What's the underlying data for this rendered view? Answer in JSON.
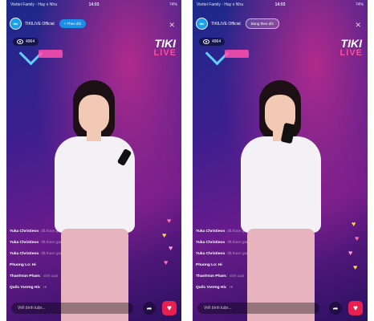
{
  "phones": [
    {
      "status": {
        "carrier": "Viettel Family - Hay o Nha",
        "time": "14:03",
        "battery": "74%"
      },
      "channel": {
        "name": "TIKILIVE Official",
        "avatar_text": "tiki",
        "follow_label": "+ Theo dõi"
      },
      "viewers": "4964",
      "brand": {
        "tiki": "TIKI",
        "live": "LIVE"
      },
      "comments": [
        {
          "name": "Yuka Christieoo",
          "msg": "đã tham gia"
        },
        {
          "name": "Yuka Christieoo",
          "msg": "đã tham gia"
        },
        {
          "name": "Yuka Christieoo",
          "msg": "đã tham gia"
        },
        {
          "name": "Phuong Lo: Hi",
          "msg": ""
        },
        {
          "name": "ThanhVan Pham:",
          "msg": "xinh quá"
        },
        {
          "name": "Quốc Vương Hà:",
          "msg": "Hi"
        }
      ],
      "chat_placeholder": "Viết bình luận..."
    },
    {
      "status": {
        "carrier": "Viettel Family - Hay o Nha",
        "time": "14:03",
        "battery": "74%"
      },
      "channel": {
        "name": "TIKILIVE Official",
        "avatar_text": "tiki",
        "follow_label": "Đang theo dõi"
      },
      "viewers": "4964",
      "brand": {
        "tiki": "TIKI",
        "live": "LIVE"
      },
      "comments": [
        {
          "name": "Yuka Christieoo",
          "msg": "đã tham gia"
        },
        {
          "name": "Yuka Christieoo",
          "msg": "đã tham gia"
        },
        {
          "name": "Yuka Christieoo",
          "msg": "đã tham gia"
        },
        {
          "name": "Phuong Lo: Hi",
          "msg": ""
        },
        {
          "name": "ThanhVan Pham:",
          "msg": "xinh quá"
        },
        {
          "name": "Quốc Vương Hà:",
          "msg": "Hi"
        }
      ],
      "chat_placeholder": "Viết bình luận..."
    }
  ],
  "icons": {
    "close": "close-icon",
    "eye": "eye-icon",
    "share": "share-icon",
    "heart": "heart-icon"
  },
  "colors": {
    "follow": "#1a8fe8",
    "like": "#e8204f",
    "live": "#ff4d9a"
  }
}
